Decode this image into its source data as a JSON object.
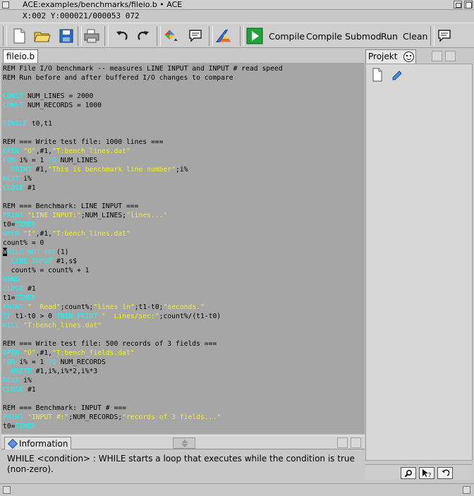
{
  "window": {
    "title": "ACE:examples/benchmarks/fileio.b • ACE",
    "status": "X:002 Y:000021/000053 072"
  },
  "toolbar": {
    "buttons": [
      "new-file-icon",
      "open-folder-icon",
      "save-icon",
      "print-icon",
      "undo-icon",
      "redo-icon",
      "palette-icon",
      "comment-icon",
      "compiler-settings-icon",
      "run-icon"
    ],
    "labels": {
      "compile": "Compile",
      "compile_submod": "Compile Submod",
      "run": "Run",
      "clean": "Clean"
    }
  },
  "editor": {
    "tab": "fileio.b",
    "lines": [
      [
        {
          "t": "REM File I/O benchmark -- measures LINE INPUT and INPUT # read speed",
          "c": "p"
        }
      ],
      [
        {
          "t": "REM Run before and after buffered I/O changes to compare",
          "c": "p"
        }
      ],
      [],
      [
        {
          "t": "CONST",
          "c": "k"
        },
        {
          "t": " NUM_LINES = 2000",
          "c": "p"
        }
      ],
      [
        {
          "t": "CONST",
          "c": "k"
        },
        {
          "t": " NUM_RECORDS = 1000",
          "c": "p"
        }
      ],
      [],
      [
        {
          "t": "SINGLE",
          "c": "k"
        },
        {
          "t": " t0,t1",
          "c": "p"
        }
      ],
      [],
      [
        {
          "t": "REM === Write test file: 1000 lines ===",
          "c": "p"
        }
      ],
      [
        {
          "t": "OPEN",
          "c": "k"
        },
        {
          "t": " ",
          "c": "p"
        },
        {
          "t": "\"O\"",
          "c": "s"
        },
        {
          "t": ",#1,",
          "c": "p"
        },
        {
          "t": "\"T:bench_lines.dat\"",
          "c": "s"
        }
      ],
      [
        {
          "t": "FOR",
          "c": "k"
        },
        {
          "t": " i% = 1 ",
          "c": "p"
        },
        {
          "t": "TO",
          "c": "k"
        },
        {
          "t": " NUM_LINES",
          "c": "p"
        }
      ],
      [
        {
          "t": "  PRINT",
          "c": "k"
        },
        {
          "t": " #1,",
          "c": "p"
        },
        {
          "t": "\"This is benchmark line number\"",
          "c": "s"
        },
        {
          "t": ";i%",
          "c": "p"
        }
      ],
      [
        {
          "t": "NEXT",
          "c": "k"
        },
        {
          "t": " i%",
          "c": "p"
        }
      ],
      [
        {
          "t": "CLOSE",
          "c": "k"
        },
        {
          "t": " #1",
          "c": "p"
        }
      ],
      [],
      [
        {
          "t": "REM === Benchmark: LINE INPUT ===",
          "c": "p"
        }
      ],
      [
        {
          "t": "PRINT",
          "c": "k"
        },
        {
          "t": " ",
          "c": "p"
        },
        {
          "t": "\"LINE INPUT:\"",
          "c": "s"
        },
        {
          "t": ";NUM_LINES;",
          "c": "p"
        },
        {
          "t": "\"lines...\"",
          "c": "s"
        }
      ],
      [
        {
          "t": "t0=",
          "c": "p"
        },
        {
          "t": "TIMER",
          "c": "k"
        }
      ],
      [
        {
          "t": "OPEN",
          "c": "k"
        },
        {
          "t": " ",
          "c": "p"
        },
        {
          "t": "\"I\"",
          "c": "s"
        },
        {
          "t": ",#1,",
          "c": "p"
        },
        {
          "t": "\"T:bench_lines.dat\"",
          "c": "s"
        }
      ],
      [
        {
          "t": "count% = 0",
          "c": "p"
        }
      ],
      [
        {
          "t": "W",
          "c": "cur"
        },
        {
          "t": "HILE NOT EOF",
          "c": "k"
        },
        {
          "t": "(1)",
          "c": "p"
        }
      ],
      [
        {
          "t": "  LINE INPUT",
          "c": "k"
        },
        {
          "t": " #1,s$",
          "c": "p"
        }
      ],
      [
        {
          "t": "  count% = count% + 1",
          "c": "p"
        }
      ],
      [
        {
          "t": "WEND",
          "c": "k"
        }
      ],
      [
        {
          "t": "CLOSE",
          "c": "k"
        },
        {
          "t": " #1",
          "c": "p"
        }
      ],
      [
        {
          "t": "t1=",
          "c": "p"
        },
        {
          "t": "TIMER",
          "c": "k"
        }
      ],
      [
        {
          "t": "PRINT",
          "c": "k"
        },
        {
          "t": " ",
          "c": "p"
        },
        {
          "t": "\"  Read\"",
          "c": "s"
        },
        {
          "t": ";count%;",
          "c": "p"
        },
        {
          "t": "\"lines in\"",
          "c": "s"
        },
        {
          "t": ";t1-t0;",
          "c": "p"
        },
        {
          "t": "\"seconds.\"",
          "c": "s"
        }
      ],
      [
        {
          "t": "IF",
          "c": "k"
        },
        {
          "t": " t1-t0 > 0 ",
          "c": "p"
        },
        {
          "t": "THEN PRINT",
          "c": "k"
        },
        {
          "t": " ",
          "c": "p"
        },
        {
          "t": "\"  Lines/sec:\"",
          "c": "s"
        },
        {
          "t": ";count%/(t1-t0)",
          "c": "p"
        }
      ],
      [
        {
          "t": "KILL",
          "c": "k"
        },
        {
          "t": " ",
          "c": "p"
        },
        {
          "t": "\"T:bench_lines.dat\"",
          "c": "s"
        }
      ],
      [],
      [
        {
          "t": "REM === Write test file: 500 records of 3 fields ===",
          "c": "p"
        }
      ],
      [
        {
          "t": "OPEN",
          "c": "k"
        },
        {
          "t": " ",
          "c": "p"
        },
        {
          "t": "\"O\"",
          "c": "s"
        },
        {
          "t": ",#1,",
          "c": "p"
        },
        {
          "t": "\"T:bench_fields.dat\"",
          "c": "s"
        }
      ],
      [
        {
          "t": "FOR",
          "c": "k"
        },
        {
          "t": " i% = 1 ",
          "c": "p"
        },
        {
          "t": "TO",
          "c": "k"
        },
        {
          "t": " NUM_RECORDS",
          "c": "p"
        }
      ],
      [
        {
          "t": "  WRITE",
          "c": "k"
        },
        {
          "t": " #1,i%,i%*2,i%*3",
          "c": "p"
        }
      ],
      [
        {
          "t": "NEXT",
          "c": "k"
        },
        {
          "t": " i%",
          "c": "p"
        }
      ],
      [
        {
          "t": "CLOSE",
          "c": "k"
        },
        {
          "t": " #1",
          "c": "p"
        }
      ],
      [],
      [
        {
          "t": "REM === Benchmark: INPUT # ===",
          "c": "p"
        }
      ],
      [
        {
          "t": "PRINT",
          "c": "k"
        },
        {
          "t": " ",
          "c": "p"
        },
        {
          "t": "\"INPUT #:\"",
          "c": "s"
        },
        {
          "t": ";NUM_RECORDS;",
          "c": "p"
        },
        {
          "t": "\"records of 3 fields...\"",
          "c": "s"
        }
      ],
      [
        {
          "t": "t0=",
          "c": "p"
        },
        {
          "t": "TIMER",
          "c": "k"
        }
      ]
    ]
  },
  "info": {
    "tab": "Information",
    "text": "WHILE <condition> : WHILE starts a loop that executes while the condition is true (non-zero)."
  },
  "project": {
    "tab": "Projekt",
    "icons": [
      "smiley-icon",
      "new-project-file-icon",
      "edit-pencil-icon"
    ],
    "bottom_buttons": [
      "search-icon",
      "help-pointer-icon",
      "undo-icon"
    ]
  }
}
